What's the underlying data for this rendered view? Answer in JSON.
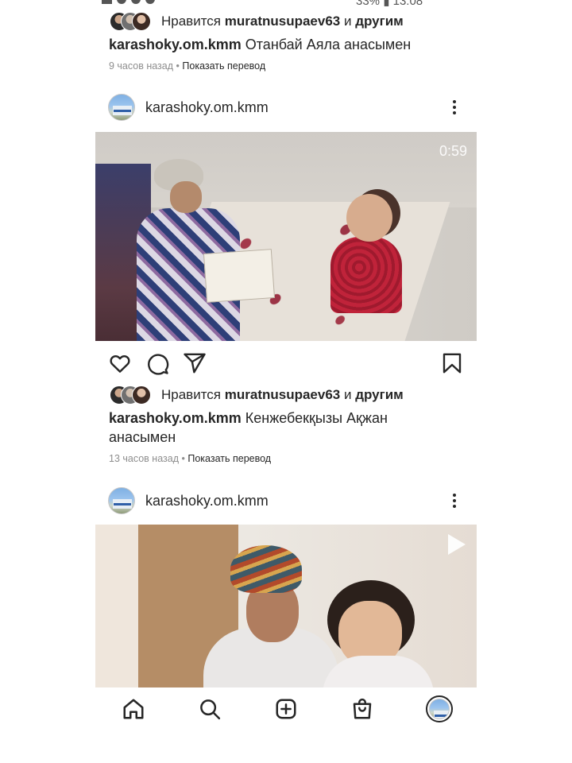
{
  "status_bar": {
    "right_text": "33% ▮ 13:08"
  },
  "posts": [
    {
      "likes": {
        "prefix": "Нравится",
        "user": "muratnusupaev63",
        "joiner": "и",
        "others": "другим"
      },
      "caption": {
        "username": "karashoky.om.kmm",
        "text": "Отанбай Аяла анасымен"
      },
      "meta": {
        "time": "9 часов назад",
        "sep": "•",
        "translate": "Показать перевод"
      }
    },
    {
      "header": {
        "username": "karashoky.om.kmm"
      },
      "video": {
        "timer": "0:59"
      },
      "likes": {
        "prefix": "Нравится",
        "user": "muratnusupaev63",
        "joiner": "и",
        "others": "другим"
      },
      "caption": {
        "username": "karashoky.om.kmm",
        "text": "Кенжебекқызы Ақжан анасымен"
      },
      "meta": {
        "time": "13 часов назад",
        "sep": "•",
        "translate": "Показать перевод"
      }
    },
    {
      "header": {
        "username": "karashoky.om.kmm"
      }
    }
  ],
  "icons": {
    "like": "heart-icon",
    "comment": "comment-icon",
    "share": "send-icon",
    "save": "bookmark-icon",
    "more": "more-vertical-icon",
    "play": "play-icon",
    "nav": [
      "home-icon",
      "search-icon",
      "add-post-icon",
      "shop-icon",
      "profile-avatar"
    ]
  }
}
